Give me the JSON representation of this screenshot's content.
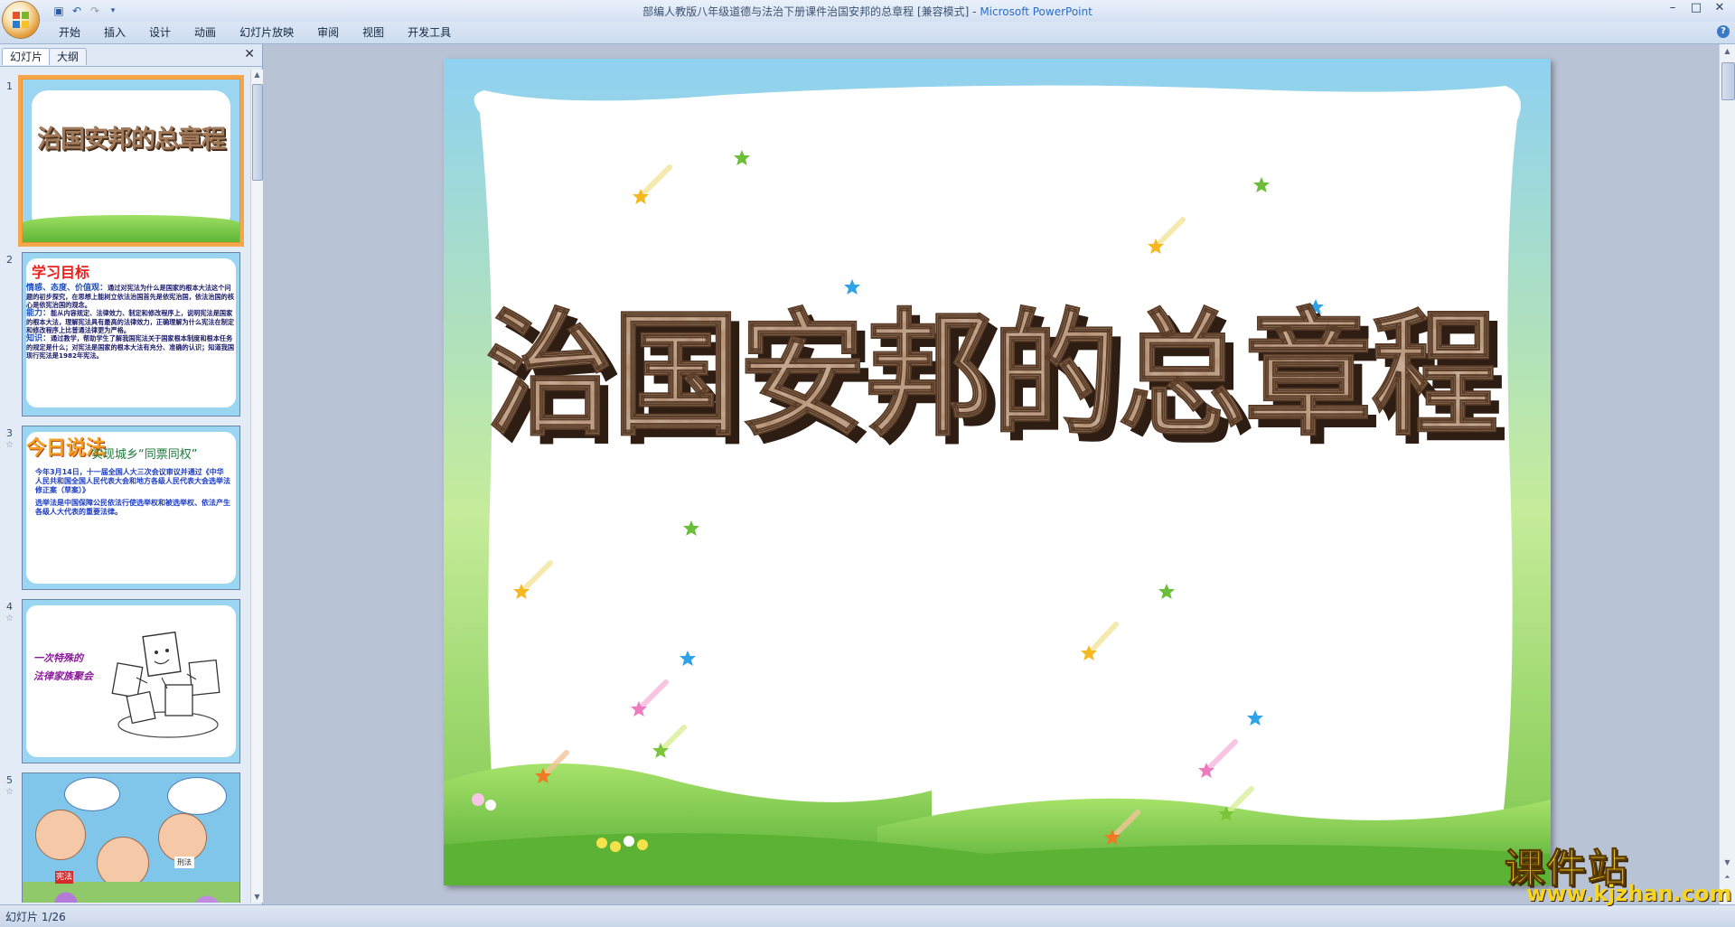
{
  "window": {
    "doc_title": "部编人教版八年级道德与法治下册课件治国安邦的总章程 [兼容模式]",
    "separator": " - ",
    "app_name": "Microsoft PowerPoint",
    "controls": [
      "minimize-icon",
      "maximize-icon",
      "close-icon"
    ]
  },
  "ribbon": {
    "tabs": [
      "开始",
      "插入",
      "设计",
      "动画",
      "幻灯片放映",
      "审阅",
      "视图",
      "开发工具"
    ]
  },
  "pane": {
    "tab_slides": "幻灯片",
    "tab_outline": "大纲"
  },
  "thumbnails": [
    {
      "number": "1",
      "title": "治国安邦的总章程"
    },
    {
      "number": "2",
      "title": "学习目标",
      "l1_head": "情感、态度、价值观：",
      "l1": "通过对宪法为什么是国家的根本大法这个问题的初步探究，在思想上能树立依法治国首先是依宪治国，依法治国的核心是依宪治国的观念。",
      "l2_head": "能力：",
      "l2": "能从内容规定、法律效力、制定和修改程序上，说明宪法是国家的根本大法，理解宪法具有最高的法律效力，正确理解为什么宪法在制定和修改程序上比普通法律更为严格。",
      "l3_head": "知识：",
      "l3": "通过教学，帮助学生了解我国宪法关于国家根本制度和根本任务的规定是什么；对宪法是国家的根本大法有充分、准确的认识；知道我国现行宪法是1982年宪法。"
    },
    {
      "number": "3",
      "logo": "今日说法",
      "title": "实现城乡“同票同权”",
      "p1": "今年3月14日，十一届全国人大三次会议审议并通过《中华人民共和国全国人民代表大会和地方各级人民代表大会选举法修正案（草案）》",
      "p2": "选举法是中国保障公民依法行使选举权和被选举权、依法产生各级人大代表的重要法律。"
    },
    {
      "number": "4",
      "line1": "一次特殊的",
      "line2": "法律家族聚会"
    },
    {
      "number": "5",
      "label_a": "宪法",
      "label_b": "刑法"
    }
  ],
  "slide": {
    "title": "治国安邦的总章程"
  },
  "status": {
    "slide_counter": "幻灯片 1/26"
  },
  "watermark": {
    "main": "课件站",
    "url": "www.kjzhan.com"
  }
}
